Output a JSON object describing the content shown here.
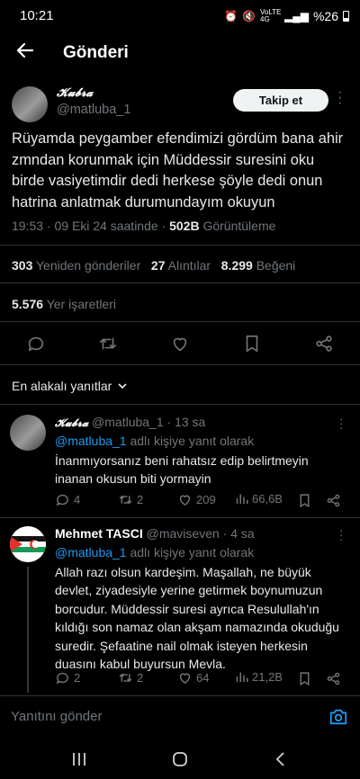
{
  "status_bar": {
    "time": "10:21",
    "network": "VoLTE 4G",
    "battery": "%26"
  },
  "header": {
    "title": "Gönderi"
  },
  "tweet": {
    "display_name": "𝓚𝓾𝓫𝓻𝓪",
    "handle": "@matluba_1",
    "follow_label": "Takip et",
    "text": "Rüyamda peygamber efendimizi gördüm bana ahir zmndan korunmak için Müddessir suresini oku birde vasiyetimdir dedi herkese şöyle dedi onun hatrina anlatmak durumundayım okuyun",
    "time": "19:53 · 09 Eki 24 saatinde · ",
    "views_count": "502B",
    "views_label": " Görüntüleme",
    "retweets_count": "303",
    "retweets_label": "Yeniden gönderiler",
    "quotes_count": "27",
    "quotes_label": "Alıntılar",
    "likes_count": "8.299",
    "likes_label": "Beğeni",
    "bookmarks_count": "5.576",
    "bookmarks_label": "Yer işaretleri"
  },
  "replies_sort": {
    "label": "En alakalı yanıtlar"
  },
  "replies": [
    {
      "display_name": "𝓚𝓾𝓫𝓻𝓪",
      "handle": "@matluba_1 · 13 sa",
      "reply_to_mention": "@matluba_1",
      "reply_to_suffix": " adlı kişiye yanıt olarak",
      "text": "İnanmıyorsanız beni rahatsız edip belirtmeyin inanan okusun biti yormayin",
      "replies": "4",
      "retweets": "2",
      "likes": "209",
      "views": "66,6B"
    },
    {
      "display_name": "Mehmet TASCI",
      "handle": "@maviseven · 4 sa",
      "reply_to_mention": "@matluba_1",
      "reply_to_suffix": " adlı kişiye yanıt olarak",
      "text": "Allah razı olsun kardeşim. Maşallah, ne büyük devlet, ziyadesiyle yerine getirmek boynumuzun borcudur. Müddessir suresi ayrıca Resulullah'ın kıldığı son namaz olan akşam namazında okuduğu suredir.  Şefaatine nail olmak isteyen herkesin duasını kabul buyursun Mevla.",
      "replies": "2",
      "retweets": "2",
      "likes": "64",
      "views": "21,2B"
    }
  ],
  "compose": {
    "placeholder": "Yanıtını gönder"
  },
  "colors": {
    "accent": "#1d9bf0",
    "text": "#e7e9ea",
    "muted": "#71767b",
    "divider": "#2f3336"
  }
}
